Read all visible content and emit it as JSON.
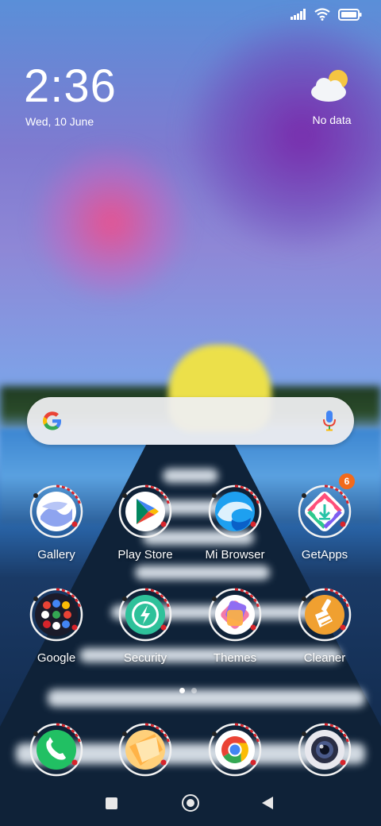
{
  "status_bar": {
    "icons": [
      "signal-icon",
      "wifi-icon",
      "battery-icon"
    ]
  },
  "clock": {
    "time": "2:36",
    "date": "Wed, 10 June"
  },
  "weather": {
    "icon": "partly-cloudy-icon",
    "text": "No data"
  },
  "search": {
    "logo": "google-g-icon",
    "mic": "mic-icon"
  },
  "apps_row1": [
    {
      "label": "Gallery",
      "icon": "gallery-icon"
    },
    {
      "label": "Play Store",
      "icon": "play-store-icon"
    },
    {
      "label": "Mi Browser",
      "icon": "mi-browser-icon"
    },
    {
      "label": "GetApps",
      "icon": "getapps-icon",
      "badge": "6"
    }
  ],
  "apps_row2": [
    {
      "label": "Google",
      "icon": "google-folder-icon"
    },
    {
      "label": "Security",
      "icon": "security-icon"
    },
    {
      "label": "Themes",
      "icon": "themes-icon"
    },
    {
      "label": "Cleaner",
      "icon": "cleaner-icon"
    }
  ],
  "page_indicator": {
    "pages": 2,
    "current": 1
  },
  "dock": [
    {
      "icon": "phone-icon"
    },
    {
      "icon": "notes-icon"
    },
    {
      "icon": "chrome-icon"
    },
    {
      "icon": "camera-icon"
    }
  ],
  "navigation": {
    "buttons": [
      "recents-button",
      "home-button",
      "back-button"
    ]
  },
  "colors": {
    "badge": "#f26a1b",
    "accent_red": "#d8242b"
  }
}
